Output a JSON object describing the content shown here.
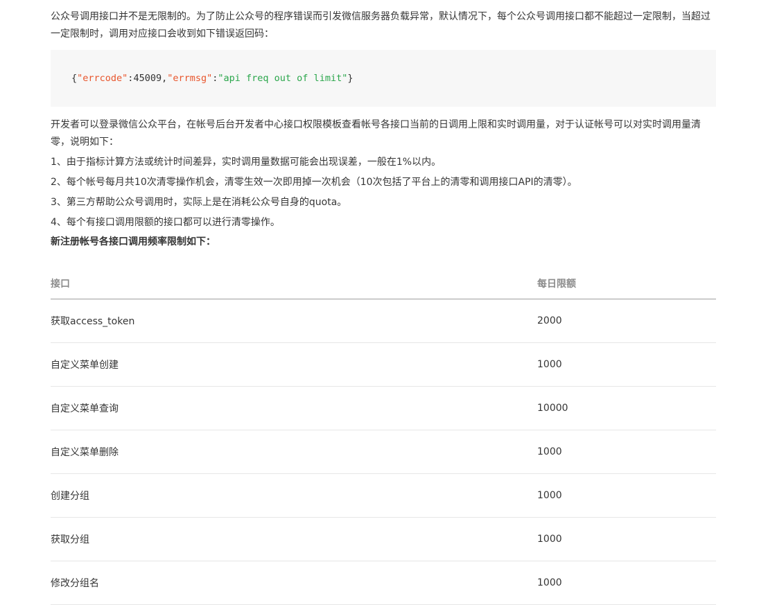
{
  "intro": "公众号调用接口并不是无限制的。为了防止公众号的程序错误而引发微信服务器负载异常，默认情况下，每个公众号调用接口都不能超过一定限制，当超过一定限制时，调用对应接口会收到如下错误返回码：",
  "code": {
    "open": "{",
    "key1": "\"errcode\"",
    "colon1": ":",
    "val1": "45009",
    "comma": ",",
    "key2": "\"errmsg\"",
    "colon2": ":",
    "val2": "\"api freq out of limit\"",
    "close": "}"
  },
  "explain": "开发者可以登录微信公众平台，在帐号后台开发者中心接口权限模板查看帐号各接口当前的日调用上限和实时调用量，对于认证帐号可以对实时调用量清零，说明如下：",
  "notes": [
    "1、由于指标计算方法或统计时间差异，实时调用量数据可能会出现误差，一般在1%以内。",
    "2、每个帐号每月共10次清零操作机会，清零生效一次即用掉一次机会（10次包括了平台上的清零和调用接口API的清零）。",
    "3、第三方帮助公众号调用时，实际上是在消耗公众号自身的quota。",
    "4、每个有接口调用限额的接口都可以进行清零操作。"
  ],
  "table_title": "新注册帐号各接口调用频率限制如下：",
  "table": {
    "headers": [
      "接口",
      "每日限额"
    ],
    "rows": [
      [
        "获取access_token",
        "2000"
      ],
      [
        "自定义菜单创建",
        "1000"
      ],
      [
        "自定义菜单查询",
        "10000"
      ],
      [
        "自定义菜单删除",
        "1000"
      ],
      [
        "创建分组",
        "1000"
      ],
      [
        "获取分组",
        "1000"
      ],
      [
        "修改分组名",
        "1000"
      ]
    ]
  }
}
